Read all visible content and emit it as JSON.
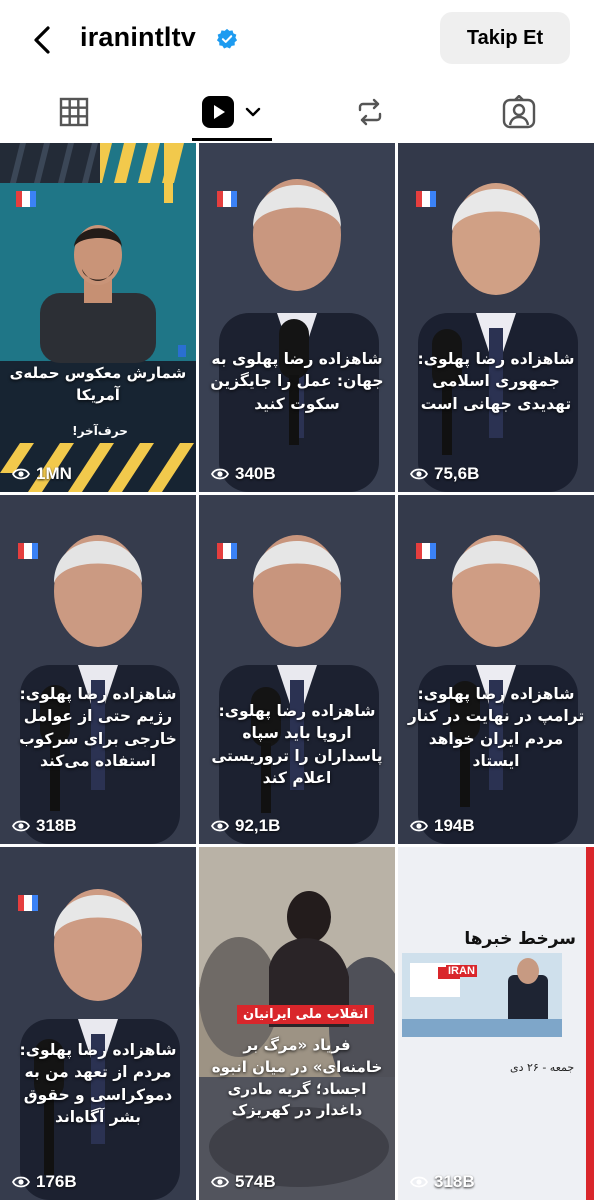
{
  "header": {
    "username": "iranintltv",
    "follow_label": "Takip Et"
  },
  "tabs": [
    "grid",
    "reels",
    "reposts",
    "tagged"
  ],
  "tiles": [
    {
      "caption": "شمارش معکوس حمله‌ی آمریکا",
      "sub": "حرف‌آخر!",
      "views": "1MN"
    },
    {
      "caption": "شاهزاده رضا پهلوی به جهان: عمل را جایگزین سکوت کنید",
      "views": "340B"
    },
    {
      "caption": "شاهزاده رضا پهلوی: جمهوری اسلامی تهدیدی جهانی است",
      "views": "75,6B"
    },
    {
      "caption": "شاهزاده رضا پهلوی: رژیم حتی از عوامل خارجی برای سرکوب استفاده می‌کند",
      "views": "318B"
    },
    {
      "caption": "شاهزاده رضا پهلوی: اروپا باید سپاه پاسداران را تروریستی اعلام کند",
      "views": "92,1B"
    },
    {
      "caption": "شاهزاده رضا پهلوی: ترامپ در نهایت در کنار مردم ایران خواهد ایستاد",
      "views": "194B"
    },
    {
      "caption": "شاهزاده رضا پهلوی: مردم از تعهد من به دموکراسی و حقوق بشر آگاه‌اند",
      "views": "176B"
    },
    {
      "tag": "انقلاب ملی ایرانیان",
      "caption": "فریاد «مرگ بر خامنه‌ای» در میان انبوه اجساد؛ گریه مادری داغدار در کهریزک",
      "views": "574B"
    },
    {
      "headline": "سرخط خبرها",
      "logo": "IRAN",
      "date": "جمعه - ۲۶ دی",
      "views": "318B"
    }
  ],
  "colors": {
    "accent_yellow": "#f2c94c",
    "verified_blue": "#1d9bf0",
    "tag_red": "#d9262b"
  }
}
